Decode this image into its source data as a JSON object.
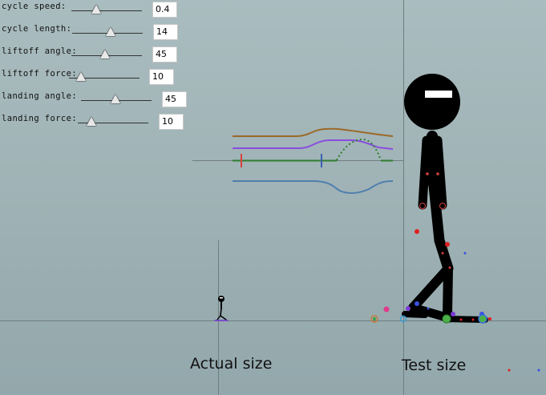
{
  "controls": [
    {
      "label": "cycle speed:",
      "value": "0.4"
    },
    {
      "label": "cycle length:",
      "value": "14"
    },
    {
      "label": "liftoff angle:",
      "value": "45"
    },
    {
      "label": "liftoff force:",
      "value": "10"
    },
    {
      "label": "landing angle:",
      "value": "45"
    },
    {
      "label": "landing force:",
      "value": "10"
    }
  ],
  "captions": {
    "actual": "Actual size",
    "test": "Test size"
  },
  "colors": {
    "background": "#a1b4b7",
    "orange_curve": "#9a6a2a",
    "purple_curve": "#8a4de0",
    "green_curve": "#2e7d2e",
    "blue_curve": "#4f7fae",
    "red_marker": "#d84040",
    "figure": "#000000"
  }
}
